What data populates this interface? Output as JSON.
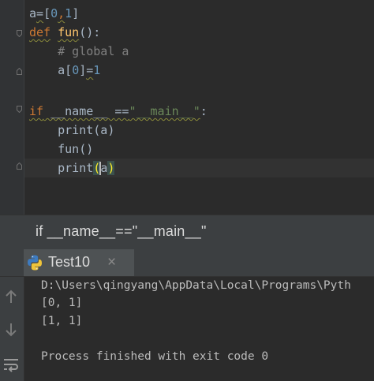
{
  "editor": {
    "lines": [
      {
        "tokens": [
          {
            "t": "a",
            "c": "plain"
          },
          {
            "t": "=",
            "c": "plain squig"
          },
          {
            "t": "[",
            "c": "plain"
          },
          {
            "t": "0",
            "c": "num"
          },
          {
            "t": ",",
            "c": "kw squig"
          },
          {
            "t": "1",
            "c": "num"
          },
          {
            "t": "]",
            "c": "plain"
          }
        ]
      },
      {
        "tokens": [
          {
            "t": "def",
            "c": "kw squig"
          },
          {
            "t": " ",
            "c": "plain"
          },
          {
            "t": "fun",
            "c": "fn squig"
          },
          {
            "t": "()",
            "c": "plain"
          },
          {
            "t": ":",
            "c": "plain"
          }
        ]
      },
      {
        "tokens": [
          {
            "t": "    ",
            "c": "plain"
          },
          {
            "t": "# global a",
            "c": "cm"
          }
        ]
      },
      {
        "tokens": [
          {
            "t": "    a[",
            "c": "plain"
          },
          {
            "t": "0",
            "c": "num"
          },
          {
            "t": "]",
            "c": "plain"
          },
          {
            "t": "=",
            "c": "plain squig"
          },
          {
            "t": "1",
            "c": "num"
          }
        ]
      },
      {
        "tokens": []
      },
      {
        "tokens": [
          {
            "t": "if",
            "c": "kw squig"
          },
          {
            "t": " __name__ ",
            "c": "plain squig"
          },
          {
            "t": "==",
            "c": "plain squig"
          },
          {
            "t": "\"__main__\"",
            "c": "str squig"
          },
          {
            "t": ":",
            "c": "plain"
          }
        ]
      },
      {
        "tokens": [
          {
            "t": "    print(a)",
            "c": "plain"
          }
        ]
      },
      {
        "tokens": [
          {
            "t": "    fun()",
            "c": "plain"
          }
        ]
      },
      {
        "tokens": [
          {
            "t": "    print",
            "c": "plain"
          },
          {
            "t": "(",
            "c": "brace"
          },
          {
            "t": "a",
            "c": "plain"
          },
          {
            "t": ")",
            "c": "brace"
          }
        ]
      }
    ]
  },
  "breadcrumb": {
    "text": "if __name__==\"__main__\""
  },
  "run": {
    "tab_title": "Test10",
    "close_label": "×",
    "output": [
      "D:\\Users\\qingyang\\AppData\\Local\\Programs\\Pyth",
      "[0, 1]",
      "[1, 1]",
      "",
      "Process finished with exit code 0"
    ]
  },
  "icons": {
    "tab_icon": "python-icon",
    "side": [
      "arrow-up-icon",
      "arrow-down-icon",
      "soft-wrap-icon"
    ]
  },
  "colors": {
    "editor_bg": "#2b2b2b",
    "keyword": "#cc7832",
    "number": "#6897bb",
    "function": "#ffc66d",
    "string": "#6a8759",
    "comment": "#808080"
  }
}
